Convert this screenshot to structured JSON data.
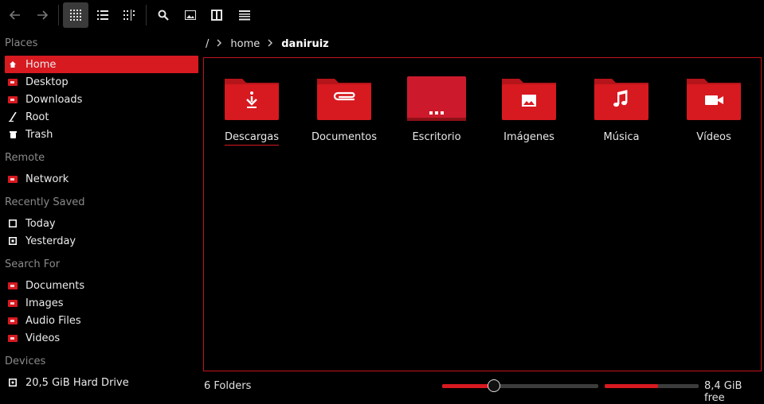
{
  "toolbar": {
    "buttons": [
      {
        "icon": "back-arrow-icon"
      },
      {
        "icon": "forward-arrow-icon"
      },
      {
        "icon": "grid-view-icon",
        "active": true
      },
      {
        "icon": "list-view-icon"
      },
      {
        "icon": "column-view-icon"
      },
      {
        "icon": "search-icon"
      },
      {
        "icon": "image-preview-icon"
      },
      {
        "icon": "split-view-icon"
      },
      {
        "icon": "menu-icon"
      }
    ]
  },
  "sidebar": {
    "places": {
      "header": "Places",
      "items": [
        {
          "label": "Home",
          "icon": "home-icon",
          "active": true
        },
        {
          "label": "Desktop",
          "icon": "desktop-folder-icon"
        },
        {
          "label": "Downloads",
          "icon": "downloads-folder-icon"
        },
        {
          "label": "Root",
          "icon": "root-icon"
        },
        {
          "label": "Trash",
          "icon": "trash-icon"
        }
      ]
    },
    "remote": {
      "header": "Remote",
      "items": [
        {
          "label": "Network",
          "icon": "network-folder-icon"
        }
      ]
    },
    "recent": {
      "header": "Recently Saved",
      "items": [
        {
          "label": "Today",
          "icon": "calendar-today-icon"
        },
        {
          "label": "Yesterday",
          "icon": "calendar-yesterday-icon"
        }
      ]
    },
    "search": {
      "header": "Search For",
      "items": [
        {
          "label": "Documents",
          "icon": "documents-folder-icon"
        },
        {
          "label": "Images",
          "icon": "images-folder-icon"
        },
        {
          "label": "Audio Files",
          "icon": "audio-folder-icon"
        },
        {
          "label": "Videos",
          "icon": "videos-folder-icon"
        }
      ]
    },
    "devices": {
      "header": "Devices",
      "items": [
        {
          "label": "20,5 GiB Hard Drive",
          "icon": "hard-drive-icon"
        }
      ]
    }
  },
  "breadcrumb": {
    "root": "/",
    "parts": [
      "home",
      "daniruiz"
    ]
  },
  "files": [
    {
      "name": "Descargas",
      "icon": "downloads-folder-icon"
    },
    {
      "name": "Documentos",
      "icon": "documents-folder-icon"
    },
    {
      "name": "Escritorio",
      "icon": "desktop-folder-icon"
    },
    {
      "name": "Imágenes",
      "icon": "images-folder-icon"
    },
    {
      "name": "Música",
      "icon": "music-folder-icon"
    },
    {
      "name": "Vídeos",
      "icon": "videos-folder-icon"
    }
  ],
  "status": {
    "count": "6 Folders",
    "free": "8,4 GiB free",
    "zoom_level": 0.33,
    "disk_used_fraction": 0.57
  },
  "colors": {
    "accent": "#d71920",
    "background": "#000000",
    "text": "#e6e6e6",
    "muted": "#8a8a8a"
  }
}
